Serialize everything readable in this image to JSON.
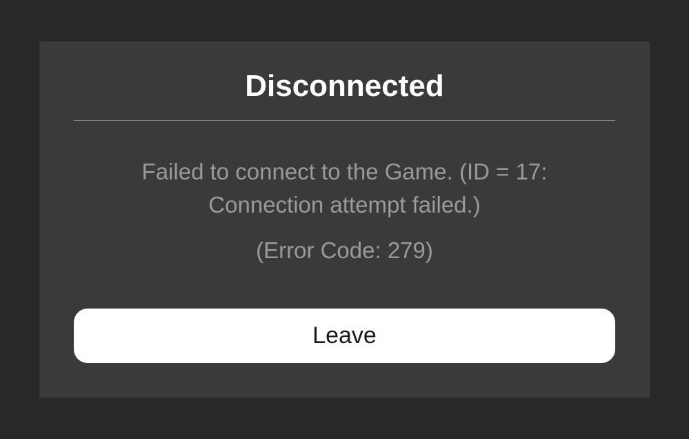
{
  "dialog": {
    "title": "Disconnected",
    "message": "Failed to connect to the Game. (ID = 17: Connection attempt failed.)",
    "errorCode": "(Error Code: 279)",
    "leave_label": "Leave"
  }
}
